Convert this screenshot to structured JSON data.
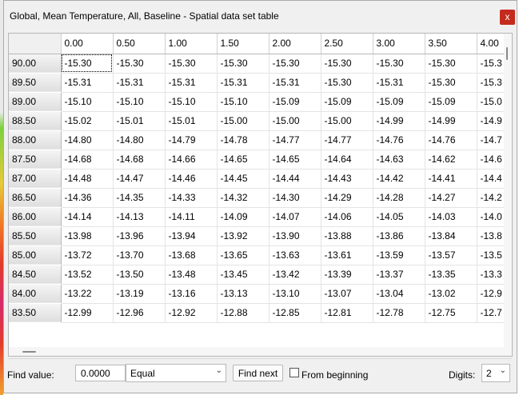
{
  "window": {
    "title": "Global, Mean Temperature, All, Baseline - Spatial data set table",
    "close_glyph": "x"
  },
  "table": {
    "columns": [
      "0.00",
      "0.50",
      "1.00",
      "1.50",
      "2.00",
      "2.50",
      "3.00",
      "3.50",
      "4.00"
    ],
    "rows": [
      {
        "label": "90.00",
        "values": [
          "-15.30",
          "-15.30",
          "-15.30",
          "-15.30",
          "-15.30",
          "-15.30",
          "-15.30",
          "-15.30",
          "-15.3"
        ]
      },
      {
        "label": "89.50",
        "values": [
          "-15.31",
          "-15.31",
          "-15.31",
          "-15.31",
          "-15.31",
          "-15.30",
          "-15.31",
          "-15.30",
          "-15.3"
        ]
      },
      {
        "label": "89.00",
        "values": [
          "-15.10",
          "-15.10",
          "-15.10",
          "-15.10",
          "-15.09",
          "-15.09",
          "-15.09",
          "-15.09",
          "-15.0"
        ]
      },
      {
        "label": "88.50",
        "values": [
          "-15.02",
          "-15.01",
          "-15.01",
          "-15.00",
          "-15.00",
          "-15.00",
          "-14.99",
          "-14.99",
          "-14.9"
        ]
      },
      {
        "label": "88.00",
        "values": [
          "-14.80",
          "-14.80",
          "-14.79",
          "-14.78",
          "-14.77",
          "-14.77",
          "-14.76",
          "-14.76",
          "-14.7"
        ]
      },
      {
        "label": "87.50",
        "values": [
          "-14.68",
          "-14.68",
          "-14.66",
          "-14.65",
          "-14.65",
          "-14.64",
          "-14.63",
          "-14.62",
          "-14.6"
        ]
      },
      {
        "label": "87.00",
        "values": [
          "-14.48",
          "-14.47",
          "-14.46",
          "-14.45",
          "-14.44",
          "-14.43",
          "-14.42",
          "-14.41",
          "-14.4"
        ]
      },
      {
        "label": "86.50",
        "values": [
          "-14.36",
          "-14.35",
          "-14.33",
          "-14.32",
          "-14.30",
          "-14.29",
          "-14.28",
          "-14.27",
          "-14.2"
        ]
      },
      {
        "label": "86.00",
        "values": [
          "-14.14",
          "-14.13",
          "-14.11",
          "-14.09",
          "-14.07",
          "-14.06",
          "-14.05",
          "-14.03",
          "-14.0"
        ]
      },
      {
        "label": "85.50",
        "values": [
          "-13.98",
          "-13.96",
          "-13.94",
          "-13.92",
          "-13.90",
          "-13.88",
          "-13.86",
          "-13.84",
          "-13.8"
        ]
      },
      {
        "label": "85.00",
        "values": [
          "-13.72",
          "-13.70",
          "-13.68",
          "-13.65",
          "-13.63",
          "-13.61",
          "-13.59",
          "-13.57",
          "-13.5"
        ]
      },
      {
        "label": "84.50",
        "values": [
          "-13.52",
          "-13.50",
          "-13.48",
          "-13.45",
          "-13.42",
          "-13.39",
          "-13.37",
          "-13.35",
          "-13.3"
        ]
      },
      {
        "label": "84.00",
        "values": [
          "-13.22",
          "-13.19",
          "-13.16",
          "-13.13",
          "-13.10",
          "-13.07",
          "-13.04",
          "-13.02",
          "-12.9"
        ]
      },
      {
        "label": "83.50",
        "values": [
          "-12.99",
          "-12.96",
          "-12.92",
          "-12.88",
          "-12.85",
          "-12.81",
          "-12.78",
          "-12.75",
          "-12.7"
        ]
      }
    ]
  },
  "find": {
    "label": "Find value:",
    "value": "0.0000",
    "mode": "Equal",
    "find_next_label": "Find next",
    "from_beginning_label": "From beginning",
    "from_beginning_checked": false
  },
  "digits": {
    "label": "Digits:",
    "value": "2"
  },
  "icons": {
    "close": "close-icon",
    "dropdown": "chevron-down-icon"
  },
  "colors": {
    "close_button": "#c42b1c",
    "window_background": "#f0f0f0",
    "grid_background": "#ffffff"
  }
}
